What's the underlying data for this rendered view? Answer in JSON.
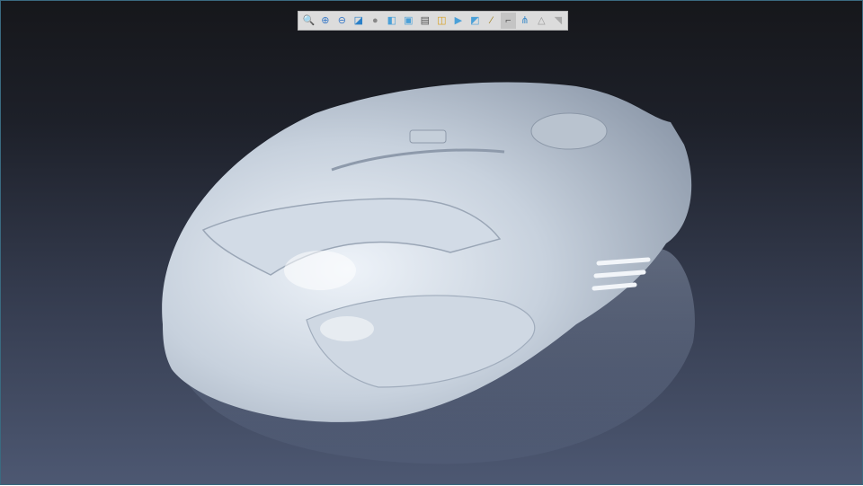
{
  "toolbar": {
    "buttons": [
      {
        "name": "fit-all",
        "glyph": "🔍",
        "color": "#3a7ac8"
      },
      {
        "name": "zoom-in",
        "glyph": "⊕",
        "color": "#3a7ac8"
      },
      {
        "name": "zoom-out",
        "glyph": "⊖",
        "color": "#3a7ac8"
      },
      {
        "name": "normal-view",
        "glyph": "◪",
        "color": "#2a80c8"
      },
      {
        "name": "shading",
        "glyph": "●",
        "color": "#888888"
      },
      {
        "name": "isometric-view",
        "glyph": "◧",
        "color": "#4aa0d8"
      },
      {
        "name": "view-mode",
        "glyph": "▣",
        "color": "#4aa0d8"
      },
      {
        "name": "capture",
        "glyph": "▤",
        "color": "#555555"
      },
      {
        "name": "multi-view",
        "glyph": "◫",
        "color": "#d8a020"
      },
      {
        "name": "hide-show",
        "glyph": "▶",
        "color": "#4aa0d8"
      },
      {
        "name": "swap-visible-space",
        "glyph": "◩",
        "color": "#4aa0d8"
      },
      {
        "name": "measure",
        "glyph": "⁄",
        "color": "#a08020"
      },
      {
        "name": "annotation",
        "glyph": "⌐",
        "color": "#555555",
        "active": true
      },
      {
        "name": "graph",
        "glyph": "⋔",
        "color": "#3a8ac8"
      },
      {
        "name": "warning",
        "glyph": "△",
        "color": "#999999"
      },
      {
        "name": "disabled-tool",
        "glyph": "◥",
        "color": "#aaaaaa"
      }
    ]
  }
}
